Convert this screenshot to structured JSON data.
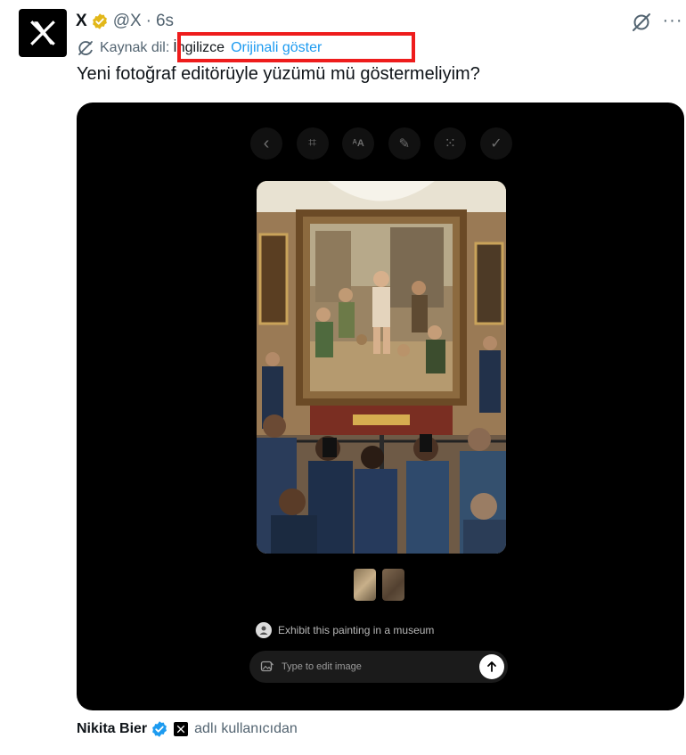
{
  "post": {
    "display_name": "X",
    "handle": "@X",
    "separator": "·",
    "time": "6s",
    "text": "Yeni fotoğraf editörüyle yüzümü mü göstermeliyim?"
  },
  "translation": {
    "label": "Kaynak dil:",
    "source_language": "İngilizce",
    "show_original": "Orijinali göster"
  },
  "icons": {
    "avatar": "x-logo-icon",
    "verified": "gold-verified-badge-icon",
    "grok": "grok-icon",
    "more": "more-options-icon",
    "translate": "translate-icon"
  },
  "more_glyph": "···",
  "media": {
    "toolbar": [
      {
        "name": "back-icon",
        "glyph": "‹"
      },
      {
        "name": "crop-icon",
        "glyph": "⌗"
      },
      {
        "name": "text-size-icon",
        "glyph": "ᴬA"
      },
      {
        "name": "draw-icon",
        "glyph": "✎"
      },
      {
        "name": "grid-icon",
        "glyph": "⁙"
      },
      {
        "name": "confirm-icon",
        "glyph": "✓"
      }
    ],
    "prompt_text": "Exhibit this painting in a museum",
    "input_placeholder": "Type to edit image"
  },
  "footer": {
    "author": "Nikita Bier",
    "suffix": "adlı kullanıcıdan"
  },
  "colors": {
    "link_blue": "#1d9bf0",
    "secondary_text": "#536471",
    "highlight_red": "#ee1c1c",
    "gold_badge": "#e2b719",
    "blue_badge": "#1d9bf0"
  }
}
